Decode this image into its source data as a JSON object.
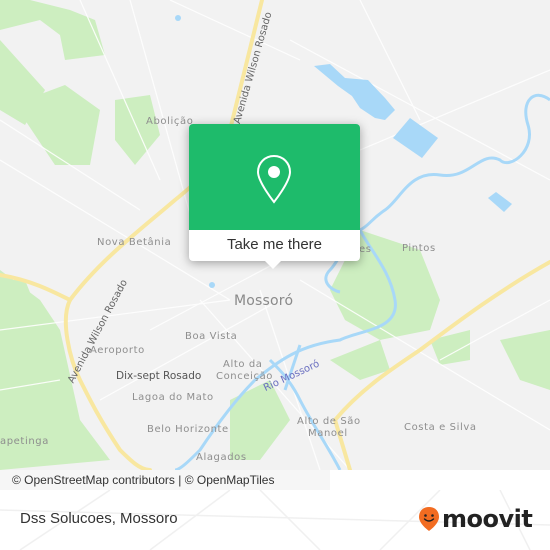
{
  "map": {
    "city_label": "Mossoró",
    "neighborhoods": [
      {
        "id": "abolicao",
        "label": "Abolição"
      },
      {
        "id": "nova-betania",
        "label": "Nova Betânia"
      },
      {
        "id": "pintos",
        "label": "Pintos"
      },
      {
        "id": "boa-vista",
        "label": "Boa Vista"
      },
      {
        "id": "aeroporto",
        "label": "Aeroporto"
      },
      {
        "id": "alto-da-conceicao-1",
        "label": "Alto da"
      },
      {
        "id": "alto-da-conceicao-2",
        "label": "Conceição"
      },
      {
        "id": "lagoa-do-mato",
        "label": "Lagoa do Mato"
      },
      {
        "id": "belo-horizonte",
        "label": "Belo Horizonte"
      },
      {
        "id": "alagados",
        "label": "Alagados"
      },
      {
        "id": "alto-de-sao-manoel-1",
        "label": "Alto de São"
      },
      {
        "id": "alto-de-sao-manoel-2",
        "label": "Manoel"
      },
      {
        "id": "costa-e-silva",
        "label": "Costa e Silva"
      },
      {
        "id": "capetinga",
        "label": "apetinga"
      },
      {
        "id": "partial-es",
        "label": "es"
      }
    ],
    "poi_label": "Dix-sept Rosado",
    "river_label": "Rio Mossoró",
    "road_labels": {
      "top": "Avenida Wilson Rosado",
      "left": "Avenida Wilson Rosado"
    },
    "colors": {
      "background": "#f2f2f2",
      "park": "#cdeec0",
      "water": "#a8d8f8",
      "major_road": "#f8e7a0",
      "minor_road": "#ffffff"
    }
  },
  "popup": {
    "icon": "location-pin-icon",
    "button_label": "Take me there",
    "accent_color": "#1ebb6b"
  },
  "attribution": "© OpenStreetMap contributors | © OpenMapTiles",
  "footer": {
    "place_name": "Dss Solucoes, Mossoro",
    "brand": "moovit",
    "brand_color": "#f26c21"
  }
}
